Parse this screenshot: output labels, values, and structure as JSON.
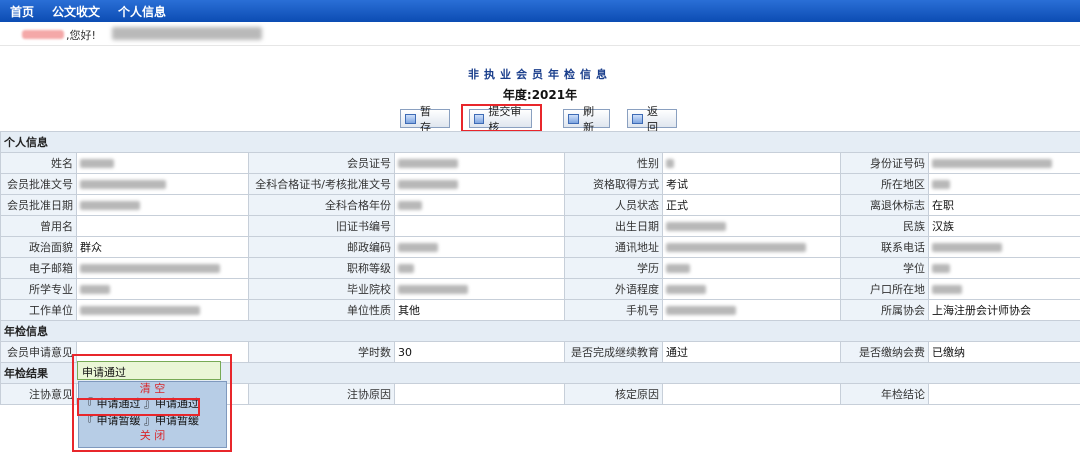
{
  "nav": {
    "home": "首页",
    "docs": "公文收文",
    "personal": "个人信息"
  },
  "greeting": {
    "hello": ",您好!"
  },
  "page": {
    "title": "非执业会员年检信息",
    "year": "年度:2021年"
  },
  "toolbar": {
    "save": "暂 存",
    "submit": "提交审核",
    "refresh": "刷新",
    "back": "返 回"
  },
  "sections": {
    "personal": "个人信息",
    "annual": "年检信息",
    "result": "年检结果"
  },
  "labels": {
    "name": "姓名",
    "member_no": "会员证号",
    "gender": "性别",
    "id_no": "身份证号码",
    "approval_doc": "会员批准文号",
    "cert_doc": "全科合格证书/考核批准文号",
    "qual_method": "资格取得方式",
    "region": "所在地区",
    "approval_date": "会员批准日期",
    "pass_year": "全科合格年份",
    "status": "人员状态",
    "retire": "离退休标志",
    "former_name": "曾用名",
    "old_cert": "旧证书编号",
    "birth": "出生日期",
    "ethnic": "民族",
    "political": "政治面貌",
    "postcode": "邮政编码",
    "address": "通讯地址",
    "phone": "联系电话",
    "email": "电子邮箱",
    "title": "职称等级",
    "education": "学历",
    "degree": "学位",
    "major": "所学专业",
    "school": "毕业院校",
    "language": "外语程度",
    "hukou": "户口所在地",
    "employer": "工作单位",
    "unit_type": "单位性质",
    "mobile": "手机号",
    "assoc": "所属协会",
    "opinion": "会员申请意见",
    "hours": "学时数",
    "edu_done": "是否完成继续教育",
    "fee": "是否缴纳会费",
    "reg_opinion": "注协意见",
    "reg_reason": "注协原因",
    "verify_reason": "核定原因",
    "conclusion": "年检结论"
  },
  "values": {
    "qual_method": "考试",
    "status": "正式",
    "retire": "在职",
    "ethnic": "汉族",
    "political": "群众",
    "unit_type": "其他",
    "assoc": "上海注册会计师协会",
    "opinion": "申请通过",
    "hours": "30",
    "edu_done": "通过",
    "fee": "已缴纳"
  },
  "dropdown": {
    "clear": "清 空",
    "option1": "『 申请通过 』申请通过",
    "option2": "『 申请暂缓 』申请暂缓",
    "close": "关 闭"
  }
}
